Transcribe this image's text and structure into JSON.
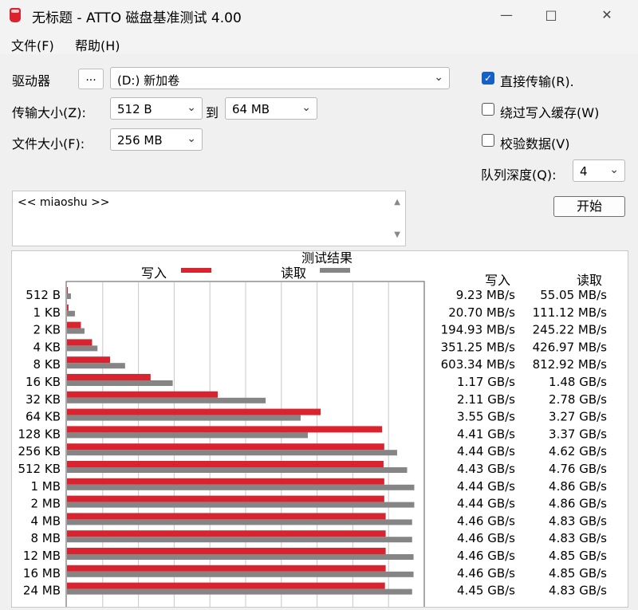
{
  "window": {
    "title": "无标题 - ATTO 磁盘基准测试 4.00",
    "min_icon": "minimize-icon",
    "max_icon": "maximize-icon",
    "close_icon": "close-icon"
  },
  "menu": [
    "文件(F)",
    "帮助(H)"
  ],
  "controls": {
    "drive_label": "驱动器",
    "browse_label": "...",
    "drive_value": "(D:) 新加卷",
    "transfer_label": "传输大小(Z):",
    "transfer_from": "512 B",
    "to_label": "到",
    "transfer_to": "64 MB",
    "file_size_label": "文件大小(F):",
    "file_size": "256 MB",
    "direct_io": {
      "label": "直接传输(R).",
      "checked": true
    },
    "bypass_cache": {
      "label": "绕过写入缓存(W)",
      "checked": false
    },
    "verify": {
      "label": "校验数据(V)",
      "checked": false
    },
    "queue_label": "队列深度(Q):",
    "queue_value": "4",
    "start_label": "开始",
    "description": "<< miaoshu >>"
  },
  "results": {
    "title": "测试结果",
    "write_label": "写入",
    "read_label": "读取",
    "col_write": "写入",
    "col_read": "读取",
    "write_color": "#d9232e",
    "read_color": "#858585",
    "rows": [
      {
        "size": "512 B",
        "write": "9.23 MB/s",
        "read": "55.05 MB/s"
      },
      {
        "size": "1 KB",
        "write": "20.70 MB/s",
        "read": "111.12 MB/s"
      },
      {
        "size": "2 KB",
        "write": "194.93 MB/s",
        "read": "245.22 MB/s"
      },
      {
        "size": "4 KB",
        "write": "351.25 MB/s",
        "read": "426.97 MB/s"
      },
      {
        "size": "8 KB",
        "write": "603.34 MB/s",
        "read": "812.92 MB/s"
      },
      {
        "size": "16 KB",
        "write": "1.17 GB/s",
        "read": "1.48 GB/s"
      },
      {
        "size": "32 KB",
        "write": "2.11 GB/s",
        "read": "2.78 GB/s"
      },
      {
        "size": "64 KB",
        "write": "3.55 GB/s",
        "read": "3.27 GB/s"
      },
      {
        "size": "128 KB",
        "write": "4.41 GB/s",
        "read": "3.37 GB/s"
      },
      {
        "size": "256 KB",
        "write": "4.44 GB/s",
        "read": "4.62 GB/s"
      },
      {
        "size": "512 KB",
        "write": "4.43 GB/s",
        "read": "4.76 GB/s"
      },
      {
        "size": "1 MB",
        "write": "4.44 GB/s",
        "read": "4.86 GB/s"
      },
      {
        "size": "2 MB",
        "write": "4.44 GB/s",
        "read": "4.86 GB/s"
      },
      {
        "size": "4 MB",
        "write": "4.46 GB/s",
        "read": "4.83 GB/s"
      },
      {
        "size": "8 MB",
        "write": "4.46 GB/s",
        "read": "4.83 GB/s"
      },
      {
        "size": "12 MB",
        "write": "4.46 GB/s",
        "read": "4.85 GB/s"
      },
      {
        "size": "16 MB",
        "write": "4.46 GB/s",
        "read": "4.85 GB/s"
      },
      {
        "size": "24 MB",
        "write": "4.45 GB/s",
        "read": "4.83 GB/s"
      }
    ]
  },
  "chart_data": {
    "type": "bar",
    "orientation": "horizontal",
    "unit": "GB/s",
    "xlim": [
      0,
      5
    ],
    "categories": [
      "512 B",
      "1 KB",
      "2 KB",
      "4 KB",
      "8 KB",
      "16 KB",
      "32 KB",
      "64 KB",
      "128 KB",
      "256 KB",
      "512 KB",
      "1 MB",
      "2 MB",
      "4 MB",
      "8 MB",
      "12 MB",
      "16 MB",
      "24 MB"
    ],
    "series": [
      {
        "name": "写入",
        "values": [
          0.00923,
          0.0207,
          0.19493,
          0.35125,
          0.60334,
          1.17,
          2.11,
          3.55,
          4.41,
          4.44,
          4.43,
          4.44,
          4.44,
          4.46,
          4.46,
          4.46,
          4.46,
          4.45
        ]
      },
      {
        "name": "读取",
        "values": [
          0.05505,
          0.11112,
          0.24522,
          0.42697,
          0.81292,
          1.48,
          2.78,
          3.27,
          3.37,
          4.62,
          4.76,
          4.86,
          4.86,
          4.83,
          4.83,
          4.85,
          4.85,
          4.83
        ]
      }
    ]
  }
}
